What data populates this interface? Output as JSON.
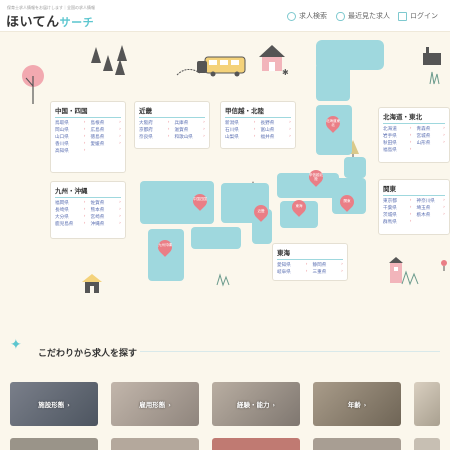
{
  "header": {
    "tagline": "保育士求人情報をお届けします｜全国の求人情報",
    "logo_main": "ほいてん",
    "logo_accent": "サーチ",
    "nav": [
      {
        "label": "求人検索",
        "icon": "search-icon"
      },
      {
        "label": "最近見た求人",
        "icon": "eye-icon"
      },
      {
        "label": "ログイン",
        "icon": "login-icon"
      }
    ]
  },
  "map": {
    "pins": [
      "北海道東北",
      "甲信越北陸",
      "関東",
      "東海",
      "近畿",
      "中国四国",
      "九州沖縄"
    ],
    "regions": {
      "chugoku": {
        "title": "中国・四国",
        "prefs": [
          "鳥取県",
          "島根県",
          "岡山県",
          "広島県",
          "山口県",
          "徳島県",
          "香川県",
          "愛媛県",
          "高知県"
        ]
      },
      "kinki": {
        "title": "近畿",
        "prefs": [
          "大阪府",
          "兵庫県",
          "京都府",
          "滋賀県",
          "奈良県",
          "和歌山県"
        ]
      },
      "koshinetsu": {
        "title": "甲信越・北陸",
        "prefs": [
          "新潟県",
          "長野県",
          "石川県",
          "富山県",
          "山梨県",
          "福井県"
        ]
      },
      "hokkaido": {
        "title": "北海道・東北",
        "prefs": [
          "北海道",
          "青森県",
          "岩手県",
          "宮城県",
          "秋田県",
          "山形県",
          "福島県"
        ]
      },
      "kyushu": {
        "title": "九州・沖縄",
        "prefs": [
          "福岡県",
          "佐賀県",
          "長崎県",
          "熊本県",
          "大分県",
          "宮崎県",
          "鹿児島県",
          "沖縄県"
        ]
      },
      "kanto": {
        "title": "関東",
        "prefs": [
          "東京都",
          "神奈川県",
          "千葉県",
          "埼玉県",
          "茨城県",
          "栃木県",
          "群馬県"
        ]
      },
      "tokai": {
        "title": "東海",
        "prefs": [
          "愛知県",
          "静岡県",
          "岐阜県",
          "三重県"
        ]
      }
    }
  },
  "section": {
    "title": "こだわりから求人を探す",
    "cards": [
      {
        "label": "施設形態"
      },
      {
        "label": "雇用形態"
      },
      {
        "label": "経験・能力"
      },
      {
        "label": "年齢"
      },
      {
        "label": ""
      }
    ]
  },
  "colors": {
    "accent": "#5cc6cf",
    "land": "#9fd8de",
    "pin": "#ea7e86",
    "link": "#5b6fb2",
    "background": "#fbf7ec"
  }
}
